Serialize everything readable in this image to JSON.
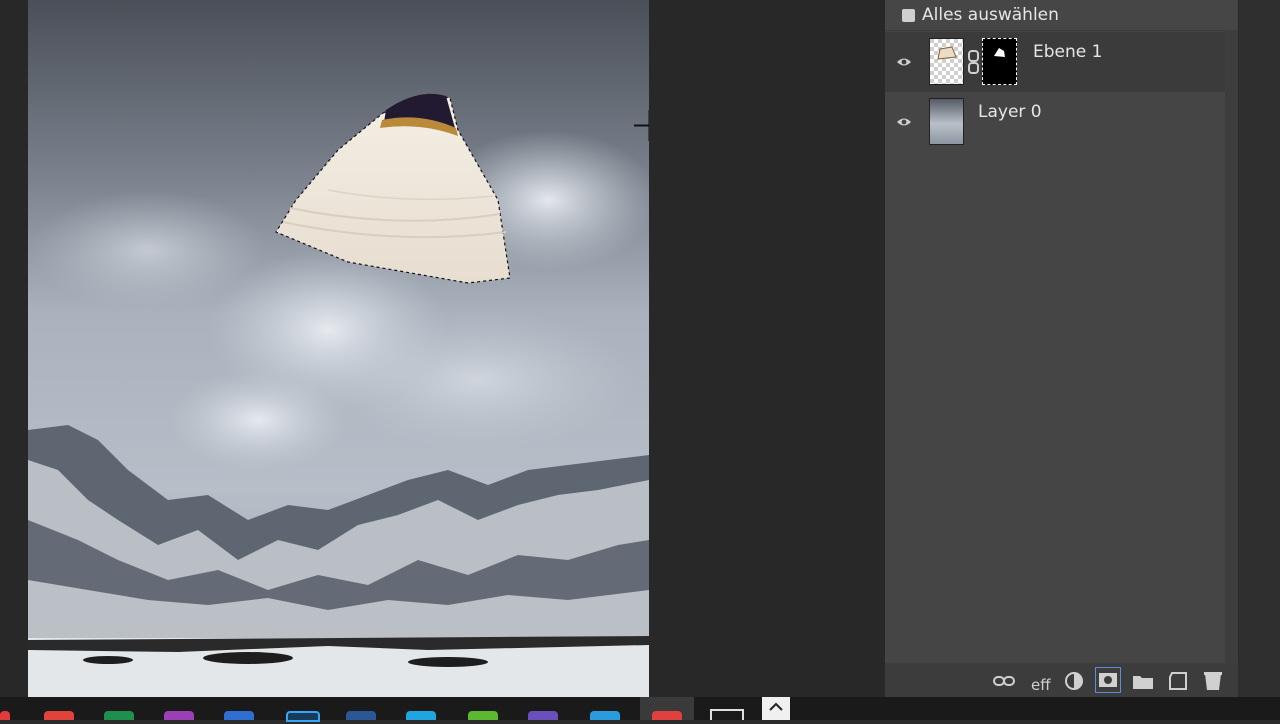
{
  "layers_panel": {
    "select_all_label": "Alles auswählen",
    "layers": [
      {
        "name": "Ebene 1",
        "visible": true,
        "has_mask": true,
        "selected": true
      },
      {
        "name": "Layer 0",
        "visible": true,
        "has_mask": false,
        "selected": false
      }
    ],
    "footer": {
      "link_icon": "link-icon",
      "effects_label": "eff",
      "adjustment_icon": "half-circle-icon",
      "mask_icon": "mask-icon",
      "folder_icon": "folder-icon",
      "new_layer_icon": "new-layer-icon",
      "delete_icon": "trash-icon"
    }
  },
  "colors": {
    "panel_bg": "#454545",
    "selected_row": "#3b3b3b",
    "text": "#e6e6e6",
    "accent_border": "#5b8bd9"
  }
}
